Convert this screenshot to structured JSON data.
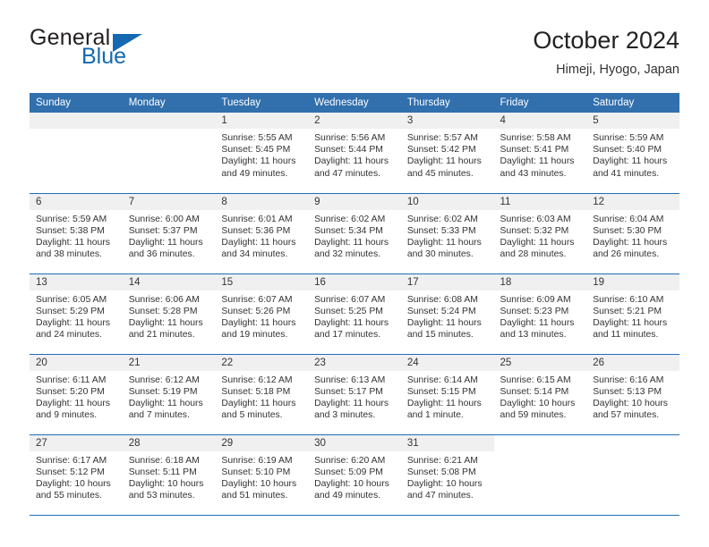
{
  "brand": {
    "name_top": "General",
    "name_bottom": "Blue",
    "accent_color": "#1469b0"
  },
  "header": {
    "title": "October 2024",
    "subtitle": "Himeji, Hyogo, Japan"
  },
  "calendar": {
    "header_bg": "#316fad",
    "row_divider_color": "#1f6eb5",
    "daynum_bg": "#f0f0f0",
    "weekday_headers": [
      "Sunday",
      "Monday",
      "Tuesday",
      "Wednesday",
      "Thursday",
      "Friday",
      "Saturday"
    ],
    "weeks": [
      [
        {
          "day": "",
          "lines": []
        },
        {
          "day": "",
          "lines": []
        },
        {
          "day": "1",
          "lines": [
            "Sunrise: 5:55 AM",
            "Sunset: 5:45 PM",
            "Daylight: 11 hours",
            "and 49 minutes."
          ]
        },
        {
          "day": "2",
          "lines": [
            "Sunrise: 5:56 AM",
            "Sunset: 5:44 PM",
            "Daylight: 11 hours",
            "and 47 minutes."
          ]
        },
        {
          "day": "3",
          "lines": [
            "Sunrise: 5:57 AM",
            "Sunset: 5:42 PM",
            "Daylight: 11 hours",
            "and 45 minutes."
          ]
        },
        {
          "day": "4",
          "lines": [
            "Sunrise: 5:58 AM",
            "Sunset: 5:41 PM",
            "Daylight: 11 hours",
            "and 43 minutes."
          ]
        },
        {
          "day": "5",
          "lines": [
            "Sunrise: 5:59 AM",
            "Sunset: 5:40 PM",
            "Daylight: 11 hours",
            "and 41 minutes."
          ]
        }
      ],
      [
        {
          "day": "6",
          "lines": [
            "Sunrise: 5:59 AM",
            "Sunset: 5:38 PM",
            "Daylight: 11 hours",
            "and 38 minutes."
          ]
        },
        {
          "day": "7",
          "lines": [
            "Sunrise: 6:00 AM",
            "Sunset: 5:37 PM",
            "Daylight: 11 hours",
            "and 36 minutes."
          ]
        },
        {
          "day": "8",
          "lines": [
            "Sunrise: 6:01 AM",
            "Sunset: 5:36 PM",
            "Daylight: 11 hours",
            "and 34 minutes."
          ]
        },
        {
          "day": "9",
          "lines": [
            "Sunrise: 6:02 AM",
            "Sunset: 5:34 PM",
            "Daylight: 11 hours",
            "and 32 minutes."
          ]
        },
        {
          "day": "10",
          "lines": [
            "Sunrise: 6:02 AM",
            "Sunset: 5:33 PM",
            "Daylight: 11 hours",
            "and 30 minutes."
          ]
        },
        {
          "day": "11",
          "lines": [
            "Sunrise: 6:03 AM",
            "Sunset: 5:32 PM",
            "Daylight: 11 hours",
            "and 28 minutes."
          ]
        },
        {
          "day": "12",
          "lines": [
            "Sunrise: 6:04 AM",
            "Sunset: 5:30 PM",
            "Daylight: 11 hours",
            "and 26 minutes."
          ]
        }
      ],
      [
        {
          "day": "13",
          "lines": [
            "Sunrise: 6:05 AM",
            "Sunset: 5:29 PM",
            "Daylight: 11 hours",
            "and 24 minutes."
          ]
        },
        {
          "day": "14",
          "lines": [
            "Sunrise: 6:06 AM",
            "Sunset: 5:28 PM",
            "Daylight: 11 hours",
            "and 21 minutes."
          ]
        },
        {
          "day": "15",
          "lines": [
            "Sunrise: 6:07 AM",
            "Sunset: 5:26 PM",
            "Daylight: 11 hours",
            "and 19 minutes."
          ]
        },
        {
          "day": "16",
          "lines": [
            "Sunrise: 6:07 AM",
            "Sunset: 5:25 PM",
            "Daylight: 11 hours",
            "and 17 minutes."
          ]
        },
        {
          "day": "17",
          "lines": [
            "Sunrise: 6:08 AM",
            "Sunset: 5:24 PM",
            "Daylight: 11 hours",
            "and 15 minutes."
          ]
        },
        {
          "day": "18",
          "lines": [
            "Sunrise: 6:09 AM",
            "Sunset: 5:23 PM",
            "Daylight: 11 hours",
            "and 13 minutes."
          ]
        },
        {
          "day": "19",
          "lines": [
            "Sunrise: 6:10 AM",
            "Sunset: 5:21 PM",
            "Daylight: 11 hours",
            "and 11 minutes."
          ]
        }
      ],
      [
        {
          "day": "20",
          "lines": [
            "Sunrise: 6:11 AM",
            "Sunset: 5:20 PM",
            "Daylight: 11 hours",
            "and 9 minutes."
          ]
        },
        {
          "day": "21",
          "lines": [
            "Sunrise: 6:12 AM",
            "Sunset: 5:19 PM",
            "Daylight: 11 hours",
            "and 7 minutes."
          ]
        },
        {
          "day": "22",
          "lines": [
            "Sunrise: 6:12 AM",
            "Sunset: 5:18 PM",
            "Daylight: 11 hours",
            "and 5 minutes."
          ]
        },
        {
          "day": "23",
          "lines": [
            "Sunrise: 6:13 AM",
            "Sunset: 5:17 PM",
            "Daylight: 11 hours",
            "and 3 minutes."
          ]
        },
        {
          "day": "24",
          "lines": [
            "Sunrise: 6:14 AM",
            "Sunset: 5:15 PM",
            "Daylight: 11 hours",
            "and 1 minute."
          ]
        },
        {
          "day": "25",
          "lines": [
            "Sunrise: 6:15 AM",
            "Sunset: 5:14 PM",
            "Daylight: 10 hours",
            "and 59 minutes."
          ]
        },
        {
          "day": "26",
          "lines": [
            "Sunrise: 6:16 AM",
            "Sunset: 5:13 PM",
            "Daylight: 10 hours",
            "and 57 minutes."
          ]
        }
      ],
      [
        {
          "day": "27",
          "lines": [
            "Sunrise: 6:17 AM",
            "Sunset: 5:12 PM",
            "Daylight: 10 hours",
            "and 55 minutes."
          ]
        },
        {
          "day": "28",
          "lines": [
            "Sunrise: 6:18 AM",
            "Sunset: 5:11 PM",
            "Daylight: 10 hours",
            "and 53 minutes."
          ]
        },
        {
          "day": "29",
          "lines": [
            "Sunrise: 6:19 AM",
            "Sunset: 5:10 PM",
            "Daylight: 10 hours",
            "and 51 minutes."
          ]
        },
        {
          "day": "30",
          "lines": [
            "Sunrise: 6:20 AM",
            "Sunset: 5:09 PM",
            "Daylight: 10 hours",
            "and 49 minutes."
          ]
        },
        {
          "day": "31",
          "lines": [
            "Sunrise: 6:21 AM",
            "Sunset: 5:08 PM",
            "Daylight: 10 hours",
            "and 47 minutes."
          ]
        },
        {
          "day": "",
          "lines": []
        },
        {
          "day": "",
          "lines": []
        }
      ]
    ]
  }
}
